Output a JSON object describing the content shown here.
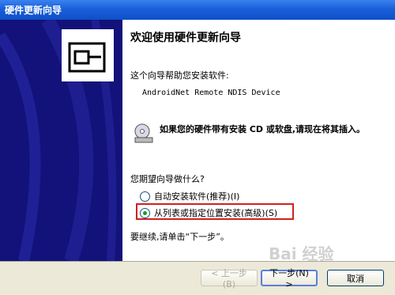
{
  "window": {
    "title": "硬件更新向导"
  },
  "main": {
    "heading": "欢迎使用硬件更新向导",
    "intro": "这个向导帮助您安装软件:",
    "device_name": "AndroidNet Remote NDIS Device",
    "cd_hint": "如果您的硬件带有安装 CD 或软盘,请现在将其插入。",
    "question": "您期望向导做什么?",
    "options": [
      {
        "label": "自动安装软件(推荐)(I)",
        "checked": false
      },
      {
        "label": "从列表或指定位置安装(高级)(S)",
        "checked": true
      }
    ],
    "continue_text": "要继续,请单击“下一步”。"
  },
  "footer": {
    "back_label": "< 上一步(B)",
    "next_label": "下一步(N) >",
    "cancel_label": "取消"
  },
  "watermark": "Bai 经验"
}
